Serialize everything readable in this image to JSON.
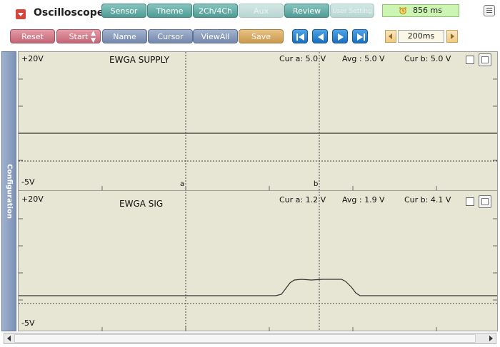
{
  "app": {
    "title": "Oscilloscope"
  },
  "tabs": [
    {
      "label": "Sensor",
      "enabled": true
    },
    {
      "label": "Theme",
      "enabled": true
    },
    {
      "label": "2Ch/4Ch",
      "enabled": true
    },
    {
      "label": "Aux",
      "enabled": false
    },
    {
      "label": "Review",
      "enabled": true
    },
    {
      "label": "User Setting",
      "enabled": false
    }
  ],
  "timer": {
    "value": "856 ms"
  },
  "controls": {
    "reset": "Reset",
    "start": "Start",
    "name": "Name",
    "cursor": "Cursor",
    "viewall": "ViewAll",
    "save": "Save"
  },
  "timebase": {
    "value": "200ms"
  },
  "sidebar": {
    "label": "Configuration"
  },
  "channels": [
    {
      "name": "EWGA SUPPLY",
      "top_label": "+20V",
      "bottom_label": "-5V",
      "cur_a": "Cur a: 5.0 V",
      "avg": "Avg  :  5.0 V",
      "cur_b": "Cur b: 5.0 V",
      "cursor_a_marker": "a",
      "cursor_b_marker": "b"
    },
    {
      "name": "EWGA SIG",
      "top_label": "+20V",
      "bottom_label": "-5V",
      "cur_a": "Cur a: 1.2 V",
      "avg": "Avg  :  1.9 V",
      "cur_b": "Cur b: 4.1 V"
    }
  ],
  "colors": {
    "scope_bg": "#e7e5d3",
    "trace": "#333333",
    "timer_bg": "#ccf5b3"
  },
  "icons": {
    "app": "oscilloscope-logo-icon",
    "timer": "alarm-clock-icon",
    "menu": "menu-icon",
    "first": "skip-first-icon",
    "prev": "step-back-icon",
    "next": "step-forward-icon",
    "last": "skip-last-icon"
  }
}
